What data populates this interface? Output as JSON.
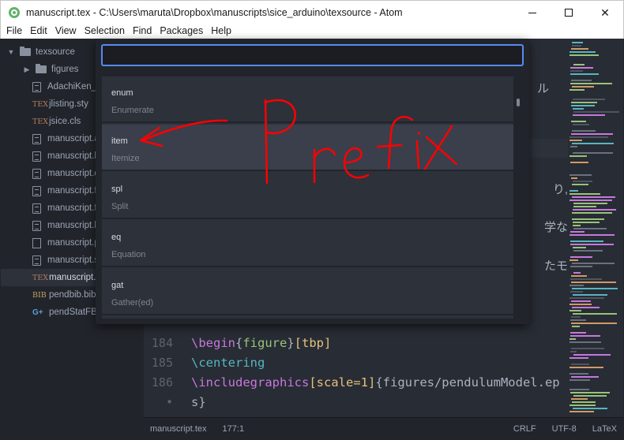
{
  "window": {
    "title": "manuscript.tex - C:\\Users\\maruta\\Dropbox\\manuscripts\\sice_arduino\\texsource - Atom",
    "minimize": "—",
    "maximize": "☐",
    "close": "✕"
  },
  "menubar": [
    "File",
    "Edit",
    "View",
    "Selection",
    "Find",
    "Packages",
    "Help"
  ],
  "tree": {
    "root": "texsource",
    "items": [
      {
        "label": "figures",
        "type": "folder"
      },
      {
        "label": "AdachiKen_s",
        "type": "file"
      },
      {
        "label": "jlisting.sty",
        "type": "tex"
      },
      {
        "label": "jsice.cls",
        "type": "tex"
      },
      {
        "label": "manuscript.a",
        "type": "file"
      },
      {
        "label": "manuscript.b",
        "type": "file"
      },
      {
        "label": "manuscript.d",
        "type": "file"
      },
      {
        "label": "manuscript.f",
        "type": "file"
      },
      {
        "label": "manuscript.f",
        "type": "file"
      },
      {
        "label": "manuscript.l",
        "type": "file"
      },
      {
        "label": "manuscript.p",
        "type": "pdf"
      },
      {
        "label": "manuscript.s",
        "type": "file"
      },
      {
        "label": "manuscript.t",
        "type": "tex",
        "selected": true
      },
      {
        "label": "pendbib.bib",
        "type": "bib"
      },
      {
        "label": "pendStatFB.cpp",
        "type": "cpp"
      }
    ]
  },
  "editor": {
    "jp_fragments": [
      "ル",
      "り,",
      "学な",
      "たモ"
    ],
    "lines": [
      {
        "num": "184",
        "cmd": "\\begin",
        "args": [
          {
            "t": "brace",
            "v": "{"
          },
          {
            "t": "arg",
            "v": "figure"
          },
          {
            "t": "brace",
            "v": "}"
          },
          {
            "t": "opt",
            "v": "[tbp]"
          }
        ]
      },
      {
        "num": "185",
        "cmd": " \\centering",
        "args": []
      },
      {
        "num": "186",
        "cmd": "\\includegraphics",
        "args": [
          {
            "t": "opt",
            "v": "[scale=1]"
          },
          {
            "t": "brace",
            "v": "{"
          },
          {
            "t": "plain",
            "v": "figures/pendulumModel.ep"
          }
        ]
      },
      {
        "num": "•",
        "cmd": "",
        "args": [
          {
            "t": "plain",
            "v": "s}"
          }
        ]
      }
    ]
  },
  "status": {
    "file": "manuscript.tex",
    "position": "177:1",
    "line_ending": "CRLF",
    "encoding": "UTF-8",
    "grammar": "LaTeX"
  },
  "autocomplete": {
    "query": "",
    "items": [
      {
        "name": "enum",
        "desc": "Enumerate"
      },
      {
        "name": "item",
        "desc": "Itemize",
        "selected": true
      },
      {
        "name": "spl",
        "desc": "Split"
      },
      {
        "name": "eq",
        "desc": "Equation"
      },
      {
        "name": "gat",
        "desc": "Gather(ed)"
      }
    ]
  },
  "annotation": {
    "text": "Prefix",
    "color": "#ff0000"
  },
  "colors": {
    "accent": "#568af2",
    "background": "#282c34",
    "panel": "#21252b"
  }
}
